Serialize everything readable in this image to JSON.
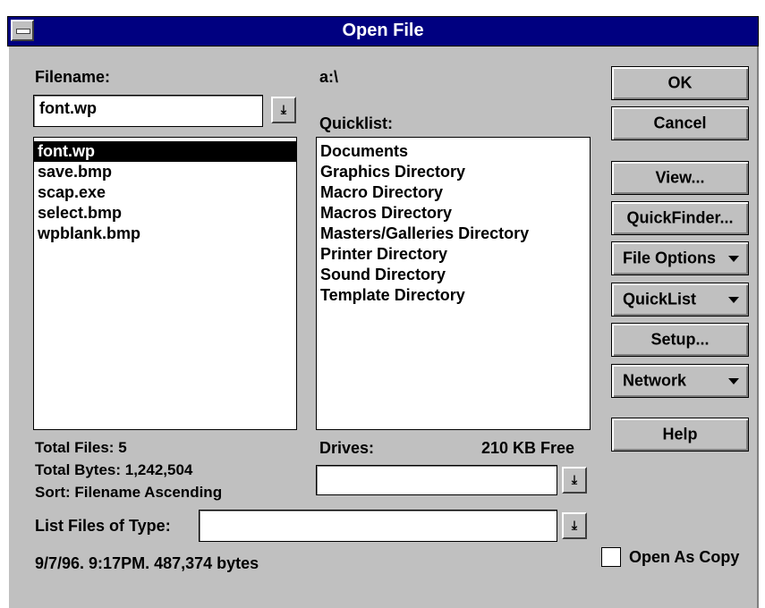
{
  "window": {
    "title": "Open File"
  },
  "filename": {
    "label": "Filename:",
    "value": "font.wp"
  },
  "files": [
    "font.wp",
    "save.bmp",
    "scap.exe",
    "select.bmp",
    "wpblank.bmp"
  ],
  "current_path": "a:\\",
  "quicklist": {
    "label": "Quicklist:",
    "items": [
      "Documents",
      "Graphics Directory",
      "Macro Directory",
      "Macros Directory",
      "Masters/Galleries Directory",
      "Printer Directory",
      "Sound Directory",
      "Template Directory"
    ]
  },
  "stats": {
    "total_files": "Total Files:   5",
    "total_bytes": "Total Bytes:   1,242,504",
    "sort": "Sort:  Filename Ascending"
  },
  "drives": {
    "label": "Drives:",
    "free": "210 KB Free",
    "value": ""
  },
  "file_type": {
    "label": "List Files of Type:",
    "value": ""
  },
  "file_info": "9/7/96.   9:17PM.  487,374 bytes",
  "buttons": {
    "ok": "OK",
    "cancel": "Cancel",
    "view": "View...",
    "quickfinder": "QuickFinder...",
    "file_options": "File Options",
    "quicklist": "QuickList",
    "setup": "Setup...",
    "network": "Network",
    "help": "Help"
  },
  "open_as_copy": {
    "label": "Open As Copy",
    "checked": false
  },
  "icons": {
    "dropdown": "down-arrow-bar-icon",
    "menu": "triangle-down-icon"
  }
}
